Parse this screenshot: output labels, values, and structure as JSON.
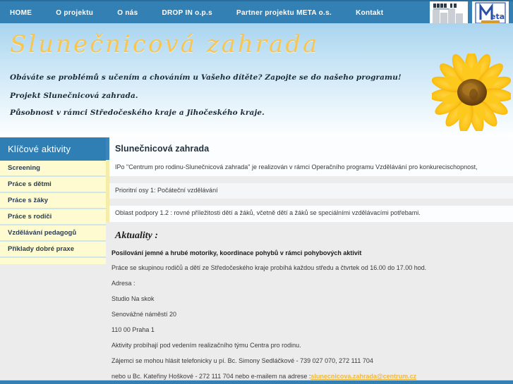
{
  "nav": {
    "items": [
      {
        "label": "HOME",
        "name": "nav-home"
      },
      {
        "label": "O projektu",
        "name": "nav-o-projektu"
      },
      {
        "label": "O nás",
        "name": "nav-o-nas"
      },
      {
        "label": "DROP IN o.p.s",
        "name": "nav-drop-in"
      },
      {
        "label": "Partner projektu META o.s.",
        "name": "nav-partner-meta"
      },
      {
        "label": "Kontakt",
        "name": "nav-kontakt"
      }
    ],
    "logos": [
      {
        "name": "drop-in-logo",
        "alt": "DROP IN",
        "text": "DROP IN"
      },
      {
        "name": "meta-logo",
        "alt": "META",
        "text": "Meta"
      }
    ]
  },
  "hero": {
    "title": "Slunečnicová zahrada",
    "lines": [
      "Obáváte se problémů s učením a chováním u Vašeho dítěte? Zapojte se do našeho programu!",
      "Projekt Slunečnicová zahrada.",
      "Působnost v rámci Středočeského kraje a Jihočeského kraje."
    ],
    "image_name": "sunflower-image"
  },
  "sidebar": {
    "header": "Klíčové aktivity",
    "items": [
      {
        "label": "Screening"
      },
      {
        "label": "Práce s dětmi"
      },
      {
        "label": "Práce s žáky"
      },
      {
        "label": "Práce s rodiči"
      },
      {
        "label": "Vzdělávání pedagogů"
      },
      {
        "label": "Příklady dobré praxe"
      }
    ]
  },
  "main": {
    "title": "Slunečnicová zahrada",
    "intro_rows": [
      "IPo \"Centrum pro rodinu-Slunečnicová zahrada\" je realizován v rámci Operačního programu Vzdělávání pro konkurecischopnost,",
      "Prioritní osy 1: Počáteční vzdělávání",
      "Oblast podpory 1.2 : rovné příležitosti dětí a žáků, včetně dětí a žáků se speciálními vzdělávacími potřebami."
    ],
    "aktuality_heading": "Aktuality :",
    "news_headline": "Posilování jemné a hrubé motoriky, koordinace pohybů v rámci pohybových aktivit",
    "body_lines": [
      "Práce se skupinou rodičů a dětí ze Středočeského kraje probíhá každou středu a čtvrtek od 16.00 do 17.00 hod.",
      "Adresa :",
      "Studio Na skok",
      "Senovážné náměstí 20",
      "110 00 Praha 1",
      "Aktivity probíhají pod vedením realizačního týmu Centra pro rodinu.",
      "Zájemci se mohou hlásit telefonicky u pí. Bc. Simony Sedláčkové - 739 027 070, 272 111 704"
    ],
    "last_line_prefix": "nebo u Bc. Kateřiny Hoškové - 272 111 704 nebo e-mailem na adrese : ",
    "email": "slunecnicova.zahrada@centrum.cz"
  },
  "colors": {
    "nav_blue": "#3380b4",
    "sidebar_header_blue": "#2f7fb5",
    "sidebar_item_yellow": "#fdfbcf",
    "title_gold": "#f6c552",
    "link_gold": "#efb840",
    "content_gray": "#ececec"
  }
}
